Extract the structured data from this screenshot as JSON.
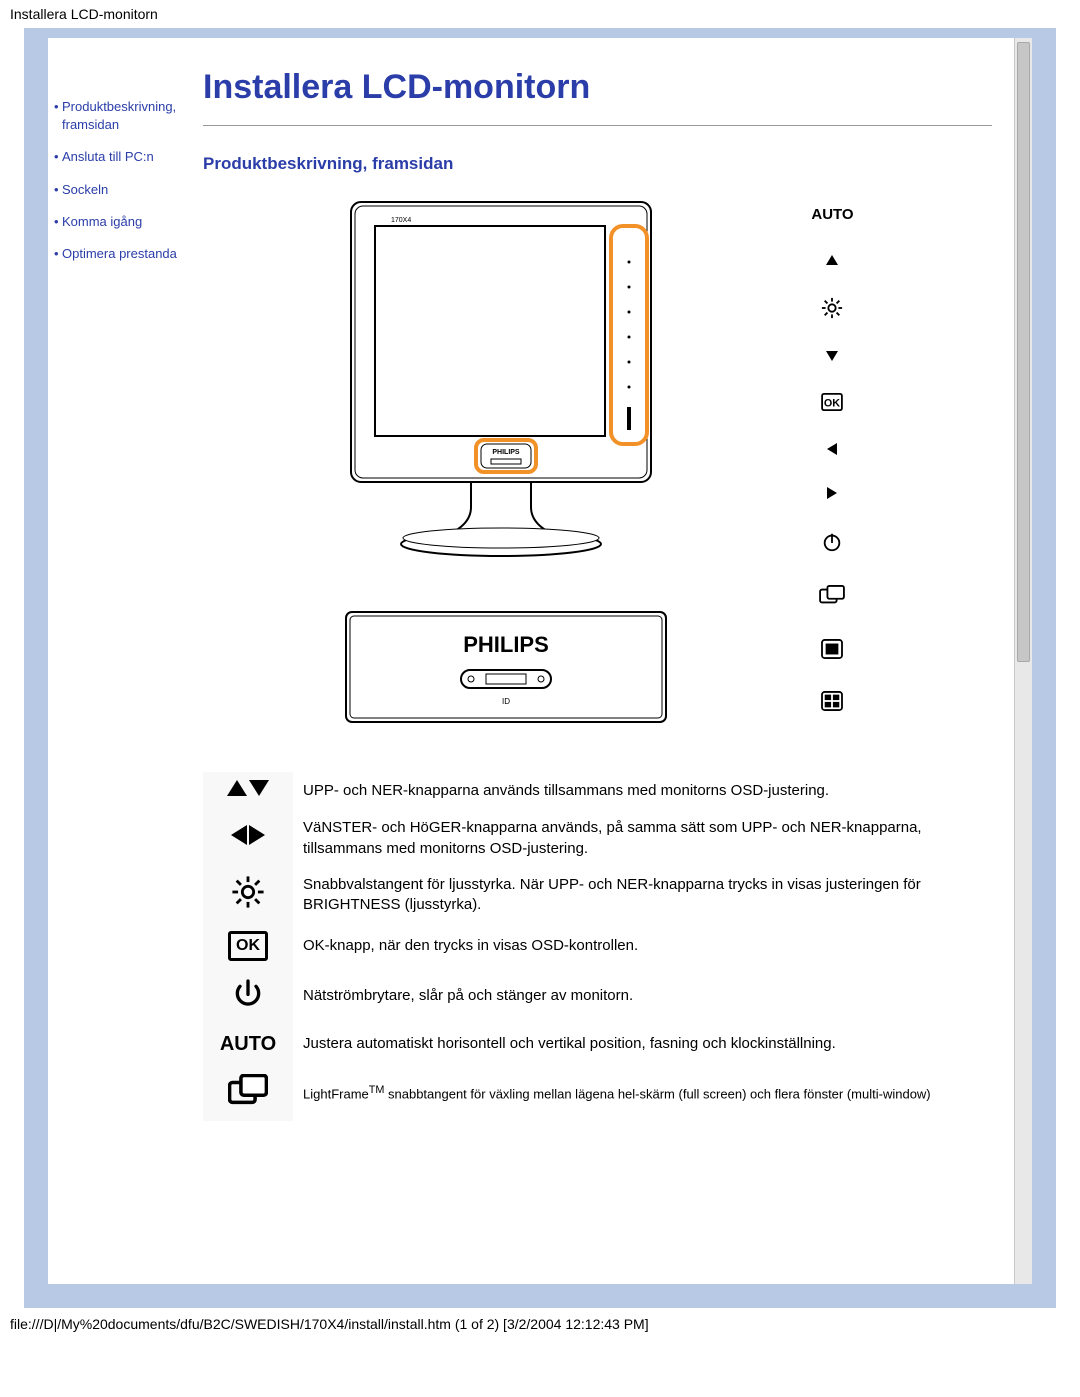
{
  "header_path": "Installera LCD-monitorn",
  "page_title": "Installera LCD-monitorn",
  "section_title": "Produktbeskrivning, framsidan",
  "sidebar": {
    "items": [
      {
        "label": "Produktbeskrivning, framsidan"
      },
      {
        "label": "Ansluta till PC:n"
      },
      {
        "label": "Sockeln"
      },
      {
        "label": "Komma igång"
      },
      {
        "label": "Optimera prestanda"
      }
    ]
  },
  "monitor_brand": "PHILIPS",
  "icon_column": {
    "auto_label": "AUTO"
  },
  "button_table": [
    {
      "icon_name": "up-down",
      "icon_glyph_html": "up-down-arrows",
      "desc": "UPP- och NER-knapparna används tillsammans med monitorns OSD-justering."
    },
    {
      "icon_name": "left-right",
      "icon_glyph_html": "left-right-arrows",
      "desc": "VäNSTER- och HöGER-knapparna används, på samma sätt som UPP- och NER-knapparna, tillsammans med monitorns OSD-justering."
    },
    {
      "icon_name": "brightness",
      "icon_glyph_html": "brightness-icon",
      "desc": "Snabbvalstangent för ljusstyrka. När UPP- och NER-knapparna trycks in visas justeringen för BRIGHTNESS (ljusstyrka)."
    },
    {
      "icon_name": "ok",
      "icon_glyph_html": "ok-box",
      "desc": "OK-knapp, när den trycks in visas OSD-kontrollen."
    },
    {
      "icon_name": "power",
      "icon_glyph_html": "power-icon",
      "desc": "Nätströmbrytare, slår på och stänger av monitorn."
    },
    {
      "icon_name": "auto",
      "icon_glyph_html": "auto-text",
      "desc": "Justera automatiskt horisontell och vertikal position, fasning och klockinställning."
    },
    {
      "icon_name": "lightframe",
      "icon_glyph_html": "lightframe-icon",
      "desc_html": "LightFrame<sup>TM</sup> snabbtangent för växling mellan lägena hel-skärm (full screen) och flera fönster (multi-window)",
      "small": true
    }
  ],
  "footer_path": "file:///D|/My%20documents/dfu/B2C/SWEDISH/170X4/install/install.htm (1 of 2) [3/2/2004 12:12:43 PM]"
}
